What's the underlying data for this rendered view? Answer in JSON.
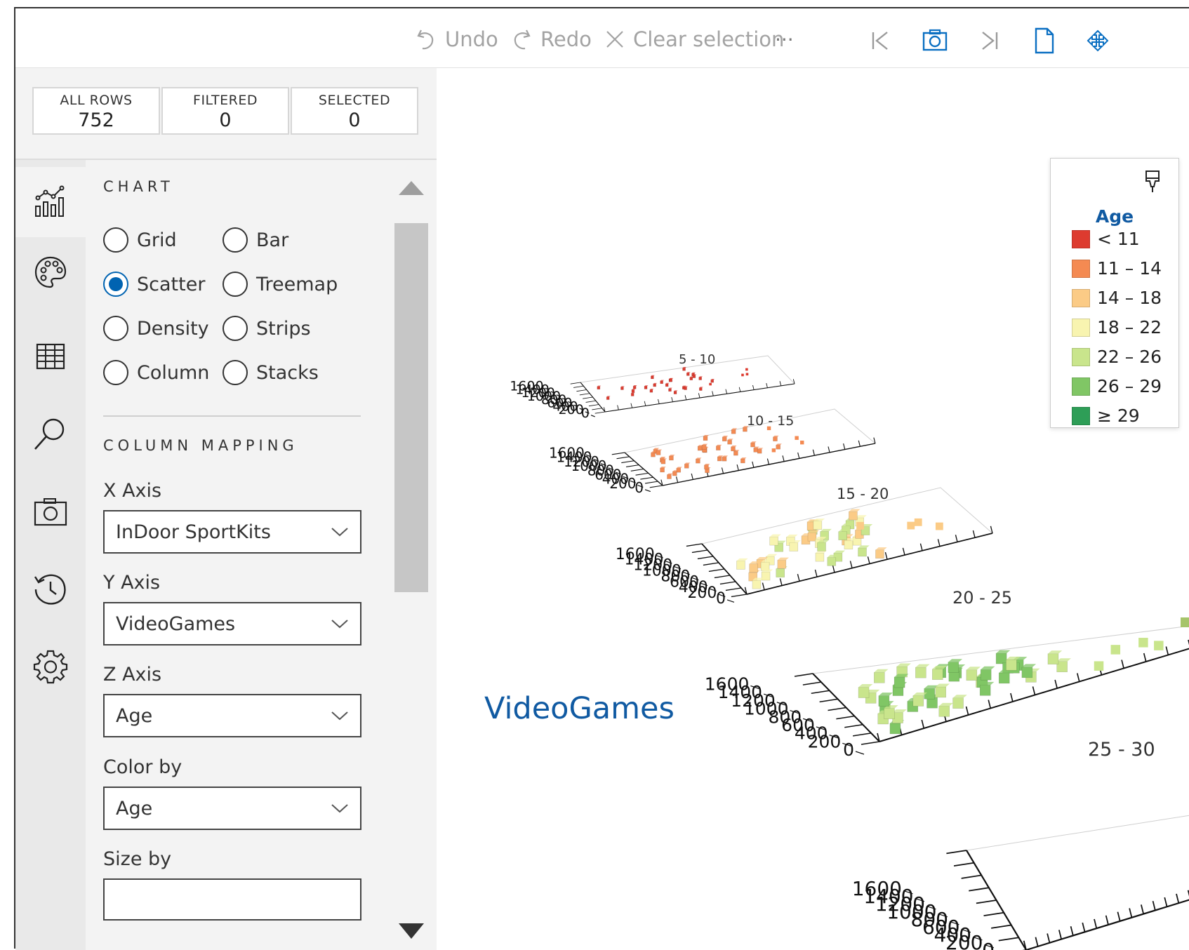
{
  "toolbar": {
    "undo_label": "Undo",
    "redo_label": "Redo",
    "clear_label": "Clear selection",
    "more_label": "···",
    "icons": [
      "undo-icon",
      "redo-icon",
      "clear-icon",
      "more-icon",
      "first-page-icon",
      "camera-icon",
      "last-page-icon",
      "page-icon",
      "move-icon"
    ]
  },
  "stats": {
    "all_rows_label": "ALL ROWS",
    "all_rows_value": "752",
    "filtered_label": "FILTERED",
    "filtered_value": "0",
    "selected_label": "SELECTED",
    "selected_value": "0"
  },
  "rail": [
    "chart-icon",
    "palette-icon",
    "table-icon",
    "search-icon",
    "camera-icon",
    "history-icon",
    "gear-icon"
  ],
  "chart_section": {
    "title": "CHART",
    "options": [
      "Grid",
      "Bar",
      "Scatter",
      "Treemap",
      "Density",
      "Strips",
      "Column",
      "Stacks"
    ],
    "selected": "Scatter"
  },
  "mapping": {
    "title": "COLUMN MAPPING",
    "x_label": "X Axis",
    "x_value": "InDoor SportKits",
    "y_label": "Y Axis",
    "y_value": "VideoGames",
    "z_label": "Z Axis",
    "z_value": "Age",
    "color_label": "Color by",
    "color_value": "Age",
    "size_label": "Size by"
  },
  "legend": {
    "title": "Age",
    "items": [
      {
        "label": "< 11",
        "color": "#dd3b2f"
      },
      {
        "label": "11 – 14",
        "color": "#f48a52"
      },
      {
        "label": "14 – 18",
        "color": "#fbcb86"
      },
      {
        "label": "18 – 22",
        "color": "#f8f4b0"
      },
      {
        "label": "22 – 26",
        "color": "#c9e58c"
      },
      {
        "label": "26 – 29",
        "color": "#80c665"
      },
      {
        "label": "≥ 29",
        "color": "#2e9e57"
      }
    ]
  },
  "chart_axis_title": "VideoGames",
  "chart_data": {
    "type": "scatter",
    "facets": [
      "5 - 10",
      "10 - 15",
      "15 - 20",
      "20 - 25",
      "25 - 30"
    ],
    "axis_ticks": [
      "0",
      "200",
      "400",
      "600",
      "800",
      "1000",
      "1200",
      "1400",
      "1600"
    ],
    "x_column": "InDoor SportKits",
    "y_column": "VideoGames",
    "z_column": "Age",
    "color_column": "Age"
  }
}
